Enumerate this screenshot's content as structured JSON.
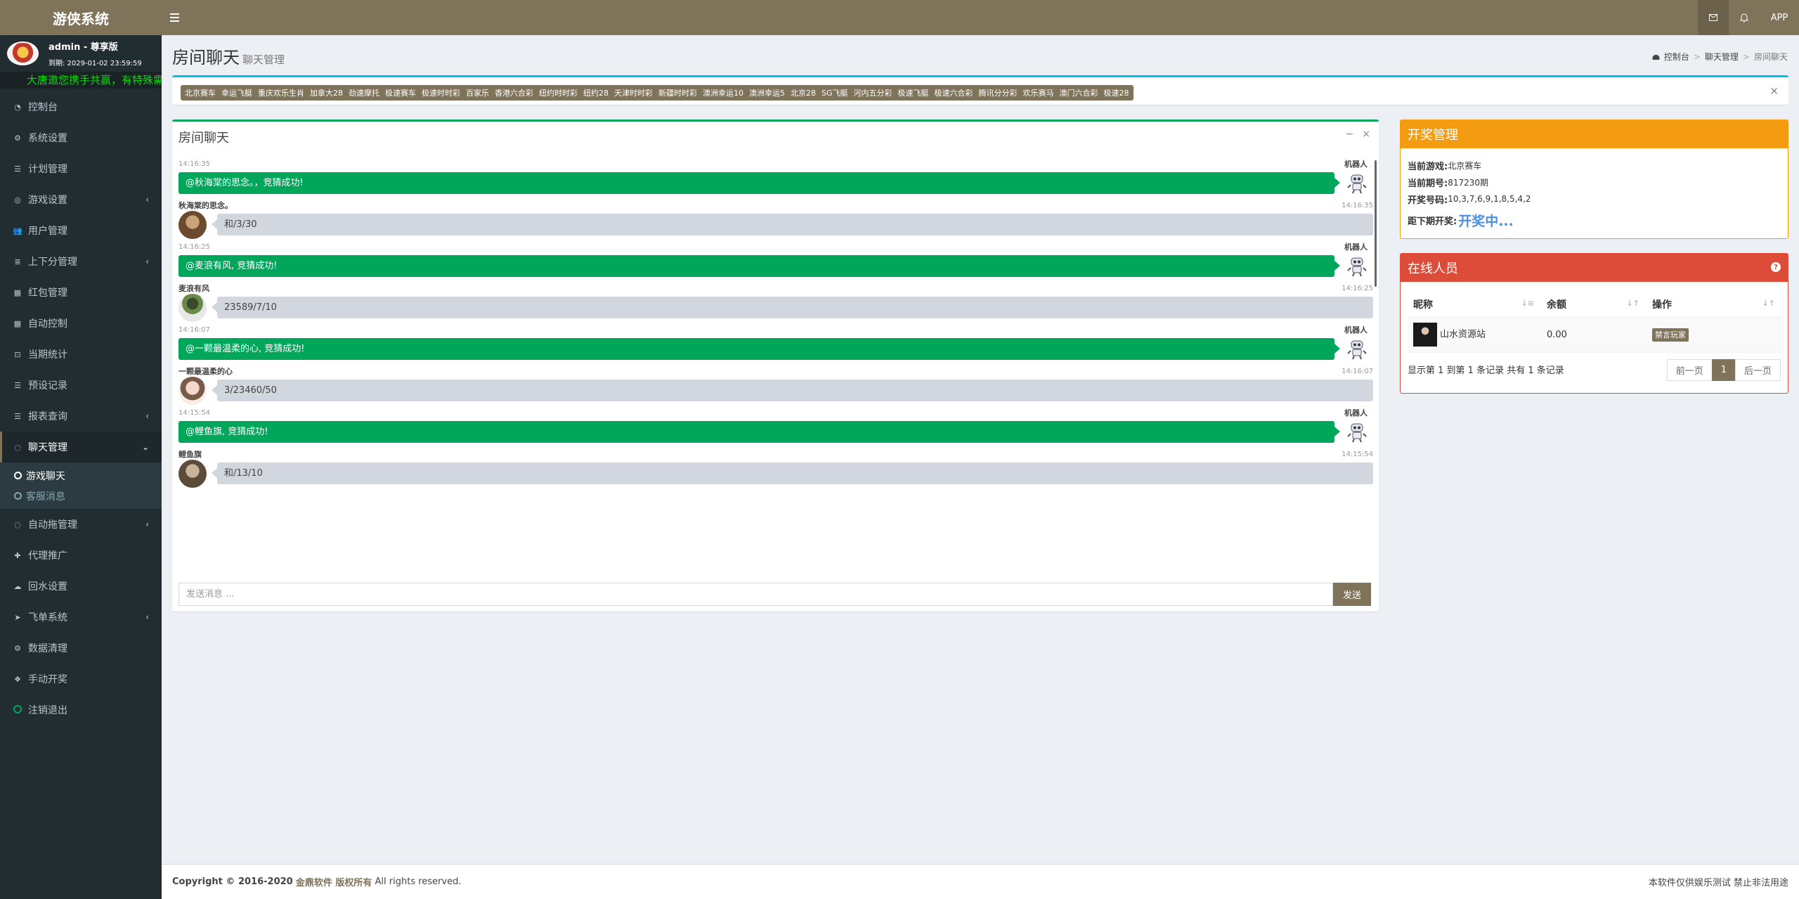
{
  "header": {
    "logo": "游侠系统",
    "app_label": "APP",
    "icons": [
      "envelope-icon",
      "bell-icon"
    ]
  },
  "sidebar": {
    "user_name": "admin - 尊享版",
    "expire": "到期: 2029-01-02 23:59:59",
    "marquee": "大唐邀您携手共赢，有特殊需求请联系客服",
    "items": [
      {
        "label": "控制台",
        "icon": "dashboard-icon",
        "has_children": false
      },
      {
        "label": "系统设置",
        "icon": "cogs-icon",
        "has_children": false
      },
      {
        "label": "计划管理",
        "icon": "list-icon",
        "has_children": false
      },
      {
        "label": "游戏设置",
        "icon": "gamepad-icon",
        "has_children": true
      },
      {
        "label": "用户管理",
        "icon": "users-icon",
        "has_children": false
      },
      {
        "label": "上下分管理",
        "icon": "database-icon",
        "has_children": true
      },
      {
        "label": "红包管理",
        "icon": "table-icon",
        "has_children": false
      },
      {
        "label": "自动控制",
        "icon": "table-icon",
        "has_children": false
      },
      {
        "label": "当期统计",
        "icon": "cart-icon",
        "has_children": false
      },
      {
        "label": "预设记录",
        "icon": "list-icon",
        "has_children": false
      },
      {
        "label": "报表查询",
        "icon": "list-icon",
        "has_children": true
      },
      {
        "label": "聊天管理",
        "icon": "comments-icon",
        "has_children": true,
        "open": true
      },
      {
        "label": "自动拖管理",
        "icon": "comment-icon",
        "has_children": true
      },
      {
        "label": "代理推广",
        "icon": "user-plus-icon",
        "has_children": false
      },
      {
        "label": "回水设置",
        "icon": "cloud-icon",
        "has_children": false
      },
      {
        "label": "飞单系统",
        "icon": "send-icon",
        "has_children": true
      },
      {
        "label": "数据清理",
        "icon": "gear-icon",
        "has_children": false
      },
      {
        "label": "手动开奖",
        "icon": "cubes-icon",
        "has_children": false
      },
      {
        "label": "注销退出",
        "icon": "circle-icon",
        "has_children": false
      }
    ],
    "submenu": [
      {
        "label": "游戏聊天",
        "active": true
      },
      {
        "label": "客服消息",
        "active": false
      }
    ]
  },
  "page": {
    "title": "房间聊天",
    "subtitle": "聊天管理",
    "breadcrumb": [
      "控制台",
      "聊天管理",
      "房间聊天"
    ]
  },
  "games": [
    "北京赛车",
    "幸运飞艇",
    "重庆欢乐生肖",
    "加拿大28",
    "劲速摩托",
    "极速赛车",
    "极速时时彩",
    "百家乐",
    "香港六合彩",
    "纽约时时彩",
    "纽约28",
    "天津时时彩",
    "新疆时时彩",
    "澳洲幸运10",
    "澳洲幸运5",
    "北京28",
    "SG飞艇",
    "河内五分彩",
    "极速飞艇",
    "极速六合彩",
    "腾讯分分彩",
    "欢乐赛马",
    "澳门六合彩",
    "极速28"
  ],
  "chat": {
    "title": "房间聊天",
    "messages": [
      {
        "type": "robot",
        "name": "机器人",
        "time": "14:16:35",
        "text": "@秋海棠的思念。，竞猜成功!"
      },
      {
        "type": "user",
        "name": "秋海棠的思念。",
        "time": "14:16:35",
        "text": "和/3/30",
        "avatar": "av1"
      },
      {
        "type": "robot",
        "name": "机器人",
        "time": "14:16:25",
        "text": "@麦浪有风, 竞猜成功!"
      },
      {
        "type": "user",
        "name": "麦浪有风",
        "time": "14:16:25",
        "text": "23589/7/10",
        "avatar": "av2"
      },
      {
        "type": "robot",
        "name": "机器人",
        "time": "14:16:07",
        "text": "@一颗最温柔的心, 竞猜成功!"
      },
      {
        "type": "user",
        "name": "一颗最温柔的心",
        "time": "14:16:07",
        "text": "3/23460/50",
        "avatar": "av3"
      },
      {
        "type": "robot",
        "name": "机器人",
        "time": "14:15:54",
        "text": "@鲤鱼旗, 竞猜成功!"
      },
      {
        "type": "user",
        "name": "鲤鱼旗",
        "time": "14:15:54",
        "text": "和/13/10",
        "avatar": "av4"
      }
    ],
    "input_placeholder": "发送消息 ...",
    "send_label": "发送"
  },
  "lottery": {
    "title": "开奖管理",
    "game_label": "当前游戏:",
    "game": "北京赛车",
    "period_label": "当前期号:",
    "period": "817230期",
    "numbers_label": "开奖号码:",
    "numbers": "10,3,7,6,9,1,8,5,4,2",
    "next_label": "距下期开奖:",
    "next_status": "开奖中..."
  },
  "online": {
    "title": "在线人员",
    "columns": [
      "昵称",
      "余额",
      "操作"
    ],
    "rows": [
      {
        "name": "山水资源站",
        "balance": "0.00",
        "action": "禁言玩家"
      }
    ],
    "info": "显示第 1 到第 1 条记录 共有 1 条记录",
    "prev": "前一页",
    "page": "1",
    "next": "后一页"
  },
  "footer": {
    "copyright": "Copyright © 2016-2020",
    "brand": "金鼎软件 版权所有",
    "rights": "All rights reserved.",
    "right_text": "本软件仅供娱乐测试 禁止非法用途"
  }
}
